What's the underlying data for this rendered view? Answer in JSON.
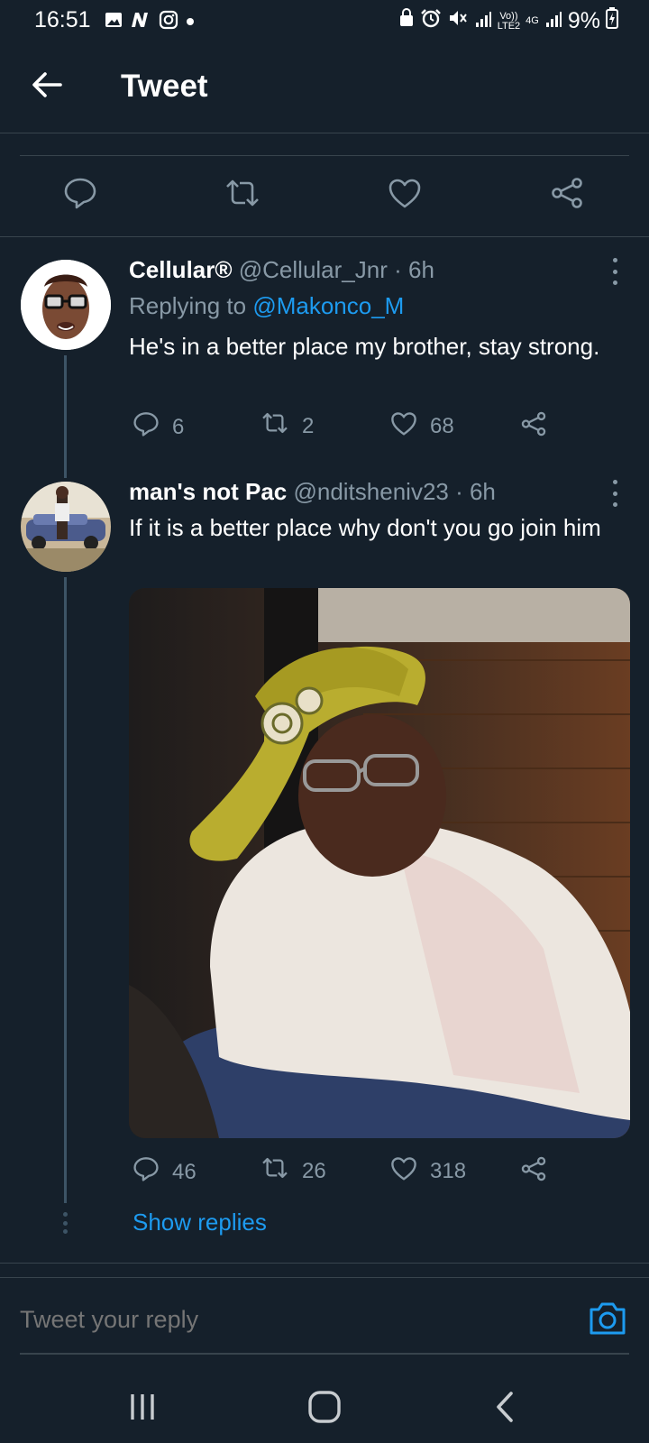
{
  "status_bar": {
    "time": "16:51",
    "left_icons": [
      "gallery-icon",
      "n-app-icon",
      "instagram-icon",
      "dot-icon"
    ],
    "network_top": "Vo))",
    "network_bottom": "LTE2",
    "net_type": "4G",
    "battery": "9%"
  },
  "header": {
    "title": "Tweet",
    "back_icon": "arrow-left-icon"
  },
  "main_actions": [
    "reply-icon",
    "retweet-icon",
    "like-icon",
    "share-icon"
  ],
  "replies": [
    {
      "name": "Cellular®",
      "handle": "@Cellular_Jnr",
      "time": "· 6h",
      "replying_prefix": "Replying to",
      "replying_to": "@Makonco_M",
      "text": "He's in a better place my brother, stay strong.",
      "reply_count": "6",
      "retweet_count": "2",
      "like_count": "68"
    },
    {
      "name": "man's not Pac",
      "handle": "@nditsheniv23",
      "time": "· 6h",
      "text": "If it is a better place why don't you go join him",
      "reply_count": "46",
      "retweet_count": "26",
      "like_count": "318"
    }
  ],
  "show_replies": "Show replies",
  "composer": {
    "placeholder": "Tweet your reply"
  },
  "colors": {
    "background": "#15202b",
    "accent": "#1d9bf0",
    "muted": "#8899a6",
    "divider": "#38444d"
  }
}
